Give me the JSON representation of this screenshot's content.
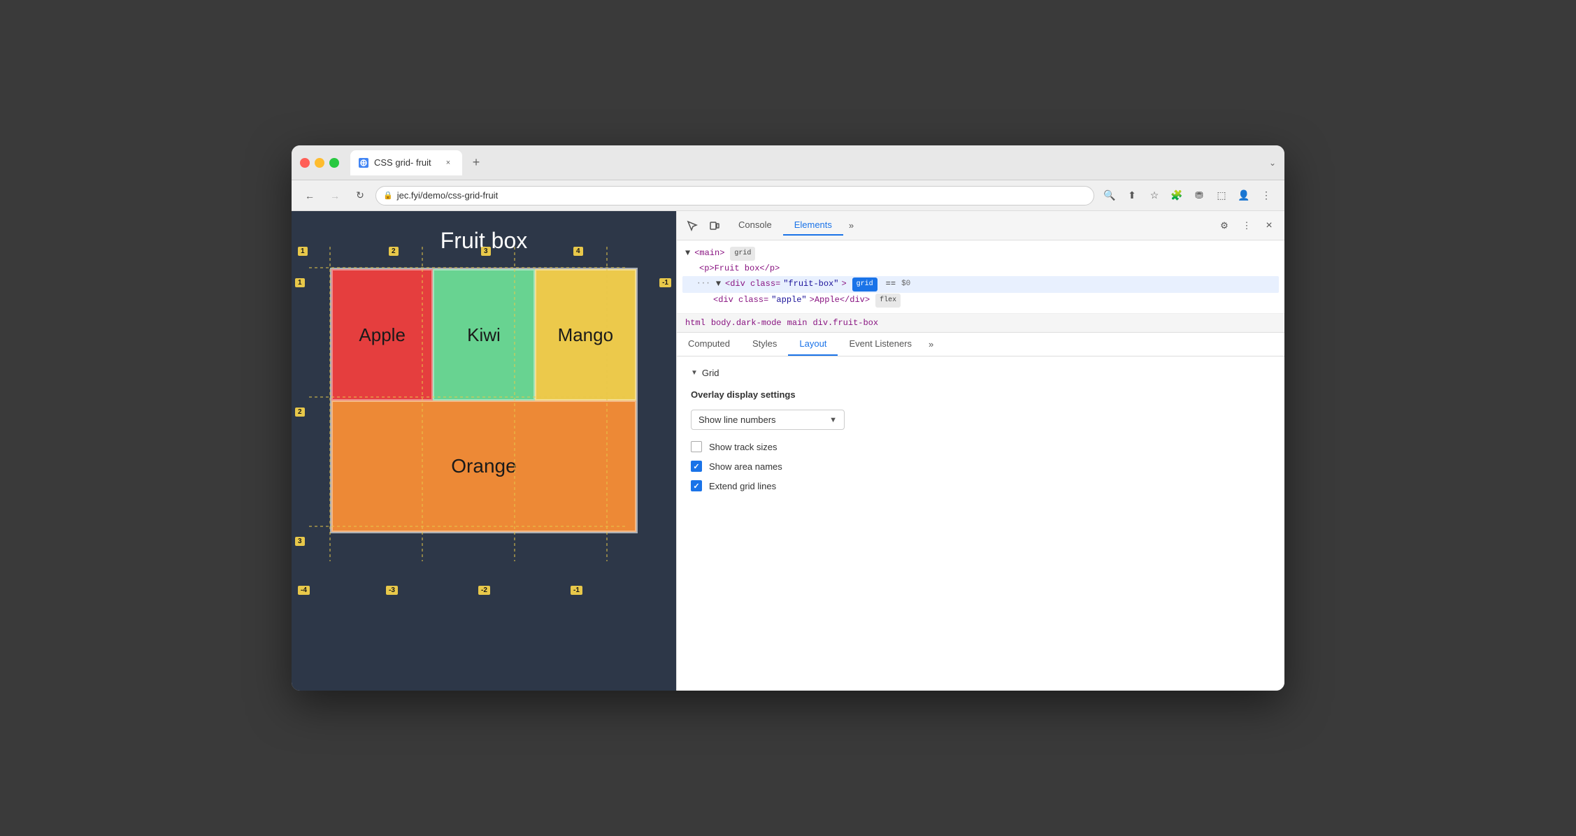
{
  "browser": {
    "tab_title": "CSS grid- fruit",
    "tab_close": "×",
    "new_tab": "+",
    "chevron_down": "⌄",
    "back_btn": "←",
    "forward_btn": "→",
    "refresh_btn": "↻",
    "address": "jec.fyi/demo/css-grid-fruit",
    "lock_icon": "🔒"
  },
  "webpage": {
    "title": "Fruit box",
    "fruits": [
      {
        "name": "Apple",
        "color": "#e53e3e"
      },
      {
        "name": "Kiwi",
        "color": "#68d391"
      },
      {
        "name": "Mango",
        "color": "#ecc94b"
      },
      {
        "name": "Orange",
        "color": "#ed8936"
      }
    ]
  },
  "devtools": {
    "toolbar": {
      "inspect_icon": "⬚",
      "device_icon": "⬜",
      "console_tab": "Console",
      "elements_tab": "Elements",
      "more_icon": "»",
      "settings_icon": "⚙",
      "menu_icon": "⋮",
      "close_icon": "×"
    },
    "dom": {
      "main_tag": "<main>",
      "main_badge": "grid",
      "p_tag": "<p>Fruit box</p>",
      "div_tag": "<div class=\"fruit-box\">",
      "div_badge": "grid",
      "div_equals": "==",
      "div_dollar": "$0",
      "div_inner": "<div class=\"apple\">Apple</div>",
      "div_inner_badge": "flex"
    },
    "breadcrumb": {
      "items": [
        "html",
        "body.dark-mode",
        "main",
        "div.fruit-box"
      ]
    },
    "panel_tabs": {
      "computed": "Computed",
      "styles": "Styles",
      "layout": "Layout",
      "event_listeners": "Event Listeners",
      "more": "»"
    },
    "layout": {
      "section_grid": "Grid",
      "overlay_title": "Overlay display settings",
      "dropdown_label": "Show line numbers",
      "checkboxes": [
        {
          "label": "Show track sizes",
          "checked": false
        },
        {
          "label": "Show area names",
          "checked": true
        },
        {
          "label": "Extend grid lines",
          "checked": true
        }
      ]
    }
  },
  "grid_badges": {
    "top_row": [
      "1",
      "2",
      "3",
      "4"
    ],
    "left_col": [
      "1",
      "2",
      "3"
    ],
    "bottom_row": [
      "-4",
      "-3",
      "-2",
      "-1"
    ],
    "right_col": [
      "-1"
    ]
  }
}
